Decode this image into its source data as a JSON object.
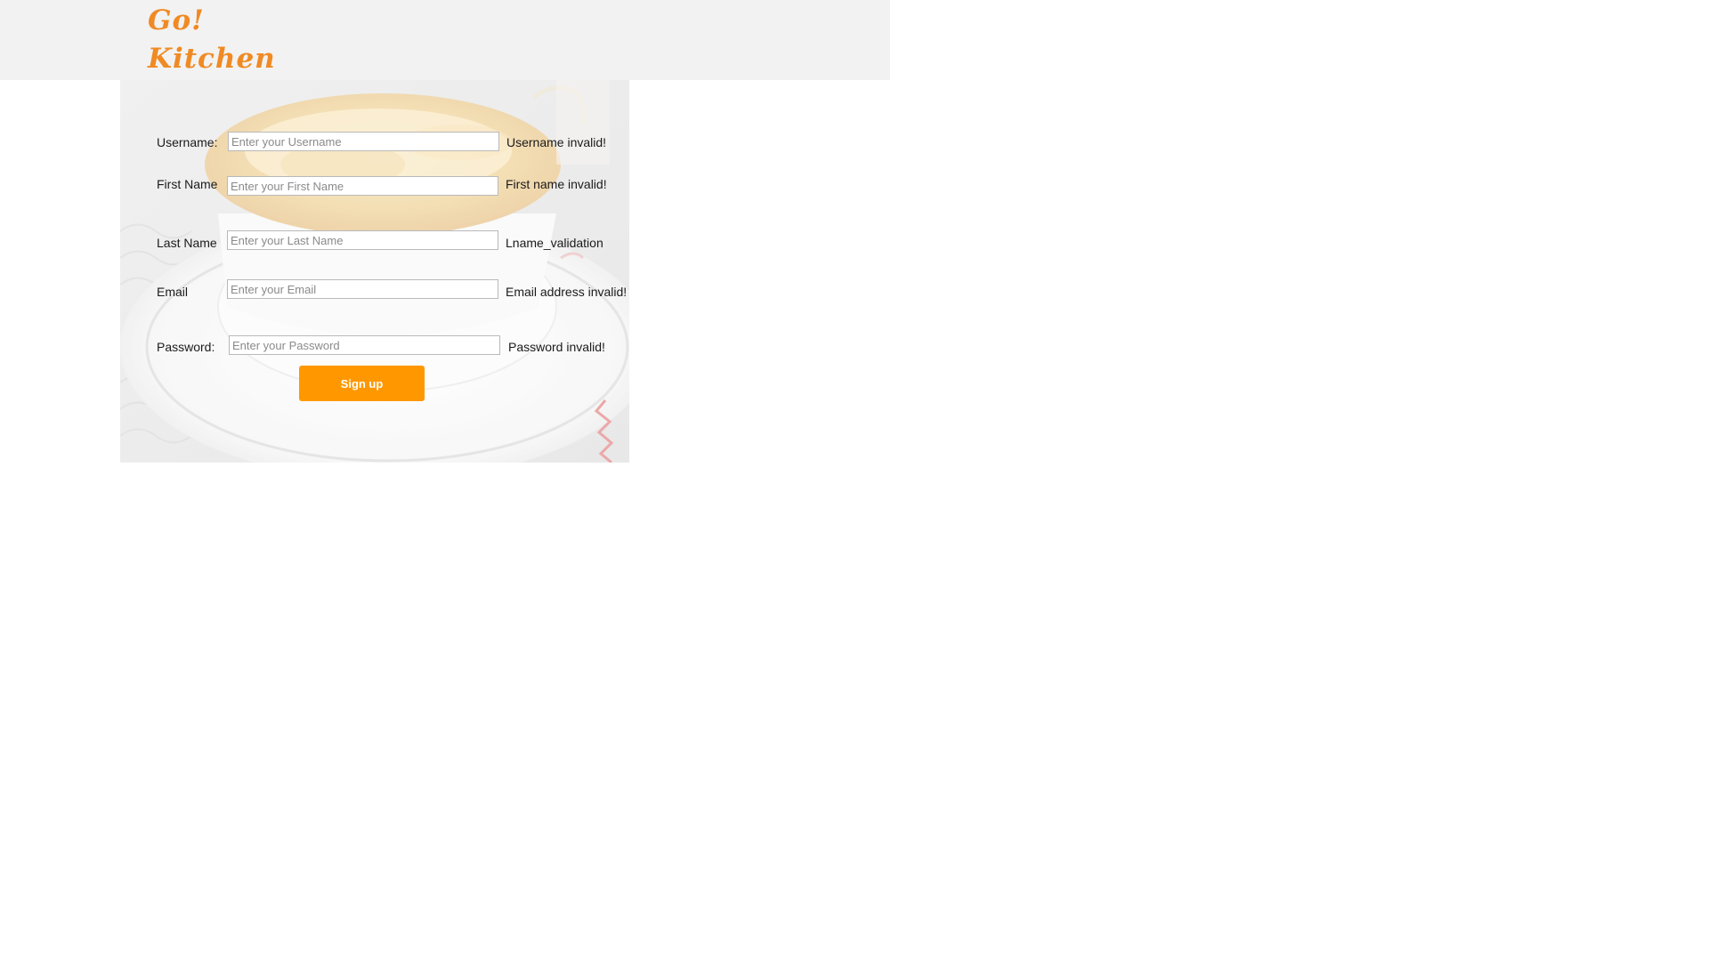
{
  "brand": {
    "line1": "Go!",
    "line2": "Kitchen",
    "color": "#f08a24"
  },
  "form": {
    "username": {
      "label": "Username:",
      "placeholder": "Enter your Username",
      "message": "Username invalid!"
    },
    "first_name": {
      "label": "First Name",
      "placeholder": "Enter your First Name",
      "message": "First name invalid!"
    },
    "last_name": {
      "label": "Last Name",
      "placeholder": "Enter your Last Name",
      "message": "Lname_validation"
    },
    "email": {
      "label": "Email",
      "placeholder": "Enter your Email",
      "message": "Email address invalid!"
    },
    "password": {
      "label": "Password:",
      "placeholder": "Enter your Password",
      "message": "Password invalid!"
    },
    "submit_label": "Sign up",
    "submit_color": "#ff9800"
  }
}
